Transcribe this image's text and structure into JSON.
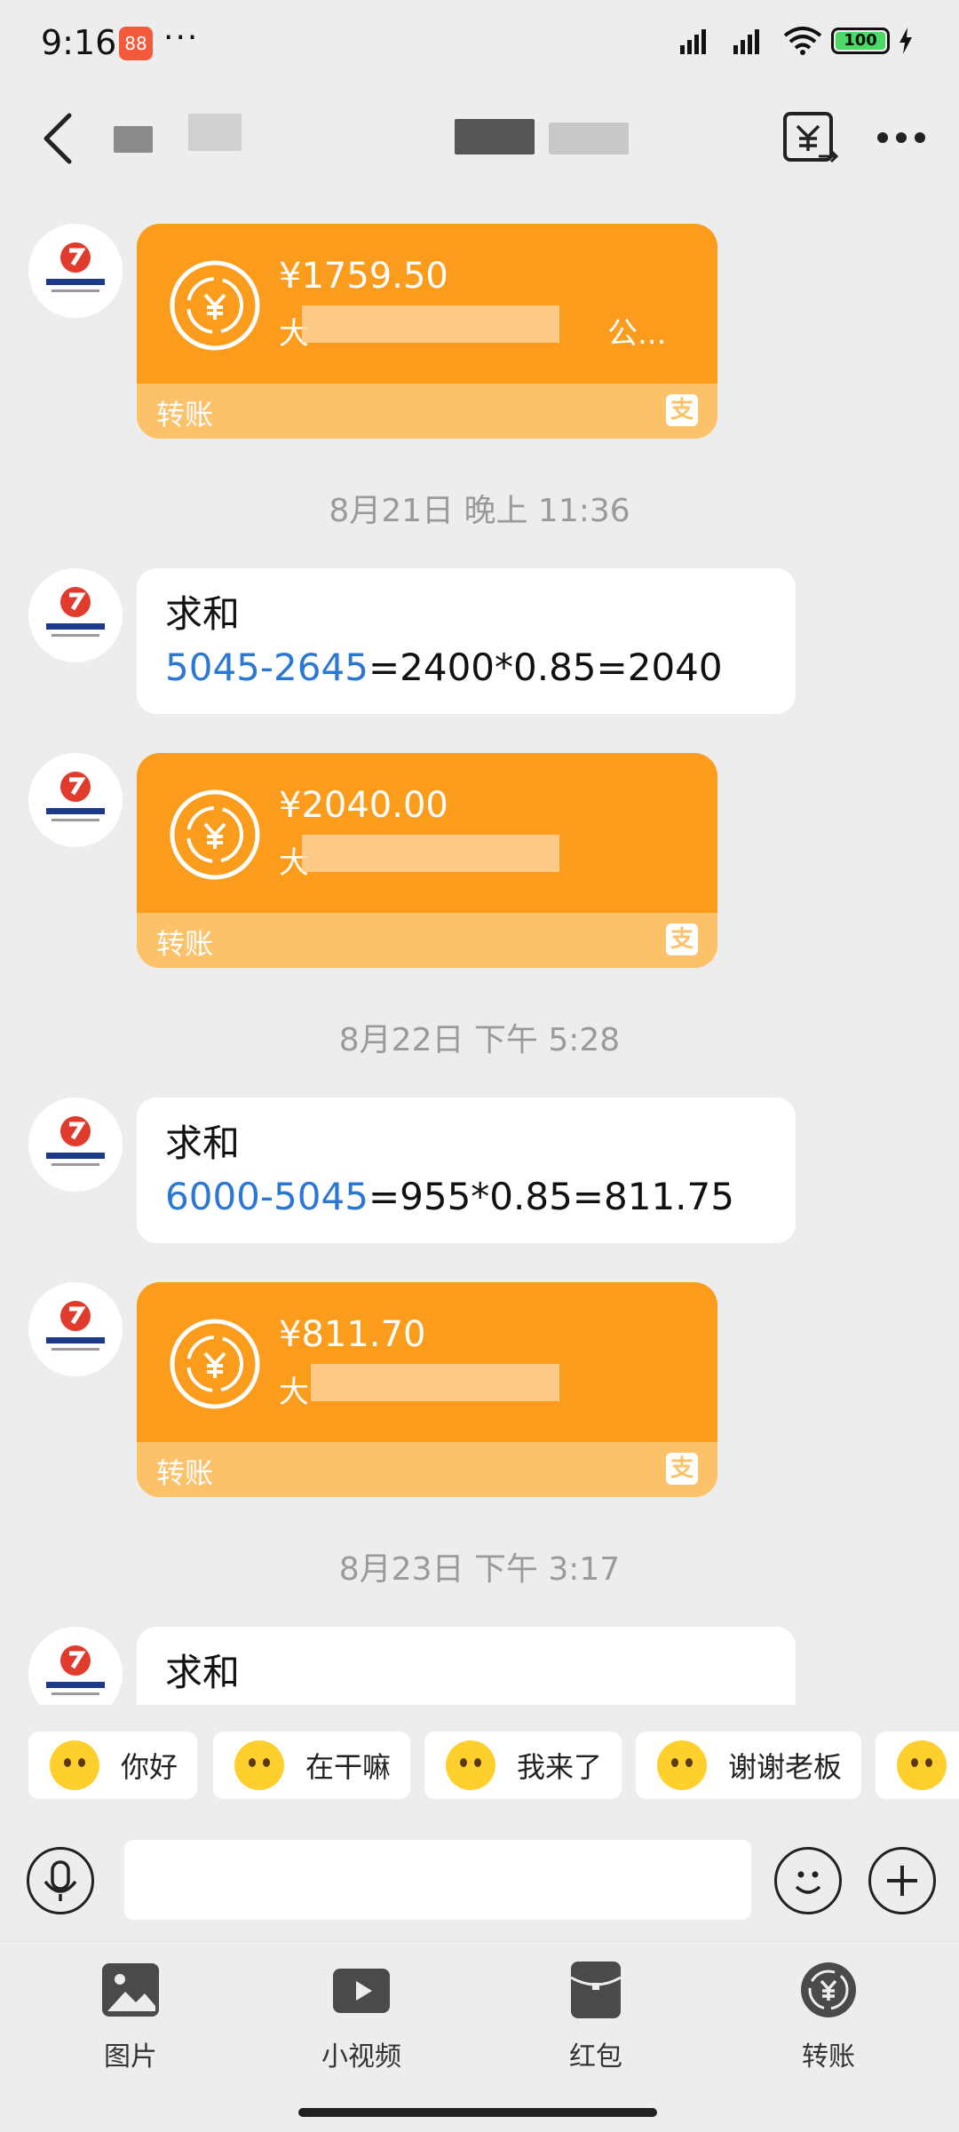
{
  "status": {
    "time": "9:16",
    "app_badge": "88",
    "more": "···",
    "battery": "100"
  },
  "messages": [
    {
      "type": "transfer",
      "amount": "¥1759.50",
      "payee": "大",
      "payee_tail": "公...",
      "label": "转账",
      "alipay": "支"
    },
    {
      "type": "time",
      "text": "8月21日 晚上 11:36"
    },
    {
      "type": "text",
      "line1": "求和",
      "blue": "5045-2645",
      "rest": "=2400*0.85=2040"
    },
    {
      "type": "transfer",
      "amount": "¥2040.00",
      "payee": "大",
      "payee_tail": "",
      "label": "转账",
      "alipay": "支"
    },
    {
      "type": "time",
      "text": "8月22日 下午 5:28"
    },
    {
      "type": "text",
      "line1": "求和",
      "blue": "6000-5045",
      "rest": "=955*0.85=811.75"
    },
    {
      "type": "transfer",
      "amount": "¥811.70",
      "payee": "大",
      "payee_tail": "",
      "label": "转账",
      "alipay": "支"
    },
    {
      "type": "time",
      "text": "8月23日 下午 3:17"
    },
    {
      "type": "text",
      "line1": "求和"
    }
  ],
  "quick_replies": [
    "你好",
    "在干嘛",
    "我来了",
    "谢谢老板"
  ],
  "tools": [
    "图片",
    "小视频",
    "红包",
    "转账"
  ],
  "colors": {
    "transfer": "#fb9c1c",
    "transfer_footer": "#fdc16a",
    "link": "#2b78d4"
  }
}
